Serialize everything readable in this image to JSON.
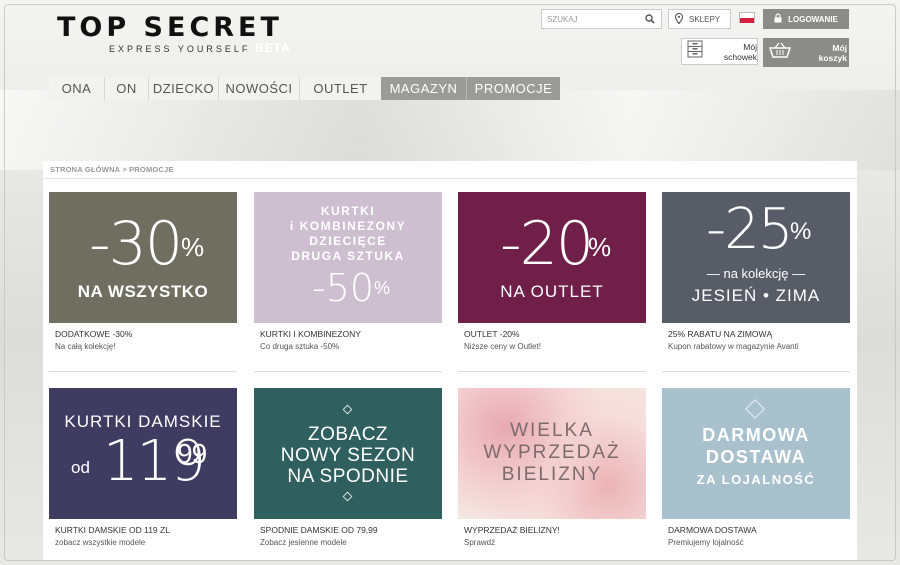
{
  "header": {
    "logo_title": "TOP SECRET",
    "logo_tagline": "EXPRESS YOURSELF",
    "logo_beta": "BETA",
    "search_placeholder": "SZUKAJ",
    "shops_label": "SKLEPY",
    "login_label": "LOGOWANIE",
    "wishlist_label": "Mój\nschowek",
    "cart_label": "Mój\nkoszyk"
  },
  "nav": {
    "tabs": [
      {
        "label": "ONA",
        "w": 56
      },
      {
        "label": "ON",
        "w": 44
      },
      {
        "label": "DZIECKO",
        "w": 70
      },
      {
        "label": "NOWOŚCI",
        "w": 81
      },
      {
        "label": "OUTLET",
        "w": 81
      },
      {
        "label": "MAGAZYN",
        "w": 86
      },
      {
        "label": "PROMOCJE",
        "w": 93
      }
    ]
  },
  "breadcrumb": "STRONA GŁÓWNA > PROMOCJE",
  "promos": [
    {
      "banner_big": "-30",
      "banner_pct": "%",
      "banner_line": "NA WSZYSTKO",
      "title": "DODATKOWE -30%",
      "subtitle": "Na całą kolekcję!",
      "color": "#6f6e60"
    },
    {
      "banner_lines": [
        "KURTKI",
        "i KOMBINEZONY",
        "DZIECIĘCE",
        "DRUGA SZTUKA"
      ],
      "banner_big": "-50",
      "banner_pct": "%",
      "title": "KURTKI I KOMBINEZONY",
      "subtitle": "Co druga sztuka -50%",
      "color": "#cdbfcf"
    },
    {
      "banner_big": "-20",
      "banner_pct": "%",
      "banner_line": "NA OUTLET",
      "title": "OUTLET -20%",
      "subtitle": "Niższe ceny w Outlet!",
      "color": "#6f1f48"
    },
    {
      "banner_big": "-25",
      "banner_pct": "%",
      "banner_line": "— na kolekcję —",
      "banner_line2": "JESIEŃ • ZIMA",
      "title": "25% RABATU NA ZIMOWĄ",
      "subtitle": "Kupon rabatowy w magazynie Avanti",
      "color": "#575c66"
    },
    {
      "banner_line": "KURTKI DAMSKIE",
      "banner_from": "od",
      "banner_big": "119",
      "banner_cents": "99",
      "title": "KURTKI DAMSKIE OD 119 ZL",
      "subtitle": "zobacz wszystkie modele",
      "color": "#3f3c62"
    },
    {
      "banner_lines": [
        "ZOBACZ",
        "NOWY SEZON",
        "NA SPODNIE"
      ],
      "title": "SPODNIE DAMSKIE OD 79,99",
      "subtitle": "Zobacz jesienne modele",
      "color": "#2f5f5e"
    },
    {
      "banner_lines": [
        "WIELKA",
        "WYPRZEDAŻ",
        "BIELIZNY"
      ],
      "title": "WYPRZEDAŻ BIELIZNY!",
      "subtitle": "Sprawdź",
      "color": "#f0c7c8"
    },
    {
      "banner_lines": [
        "DARMOWA",
        "DOSTAWA"
      ],
      "banner_line": "ZA LOJALNOŚĆ",
      "title": "DARMOWA DOSTAWA",
      "subtitle": "Premiujemy lojalność",
      "color": "#a9c1cd"
    }
  ]
}
